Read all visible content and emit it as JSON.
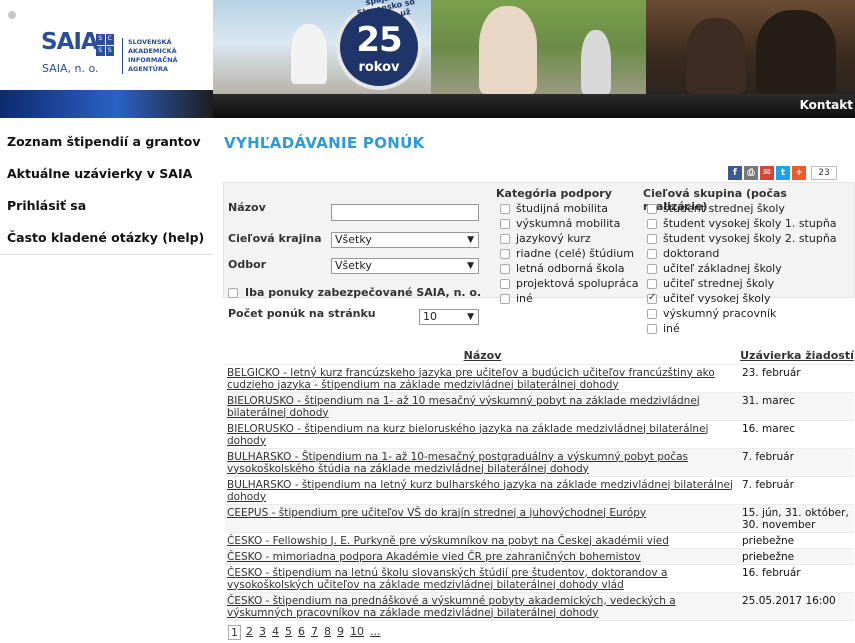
{
  "header": {
    "logo_word": "SAIA",
    "logo_grid": [
      "S",
      "C",
      "S",
      "S"
    ],
    "logo_sub": "SAIA, n. o.",
    "logo_lines": [
      "SLOVENSKÁ",
      "AKADEMICKÁ",
      "INFORMAČNÁ",
      "AGENTÚRA"
    ],
    "badge_arc": "spájame Slovensko so svetom už",
    "badge_number": "25",
    "badge_sub": "rokov",
    "nav_contact": "Kontakt"
  },
  "sidebar": {
    "items": [
      {
        "label": "Zoznam štipendií a grantov"
      },
      {
        "label": "Aktuálne uzávierky v SAIA"
      },
      {
        "label": "Prihlásiť sa"
      },
      {
        "label": "Často kladené otázky (help)"
      }
    ]
  },
  "page": {
    "title": "VYHĽADÁVANIE PONÚK",
    "share_count": "23"
  },
  "form": {
    "name_label": "Názov",
    "name_value": "",
    "country_label": "Cieľová krajina",
    "country_value": "Všetky",
    "field_label": "Odbor",
    "field_value": "Všetky",
    "saia_only_label": "Iba ponuky zabezpečované SAIA, n. o.",
    "per_page_label": "Počet ponúk na stránku",
    "per_page_value": "10",
    "category_heading": "Kategória podpory",
    "category_options": [
      {
        "label": "študijná mobilita",
        "checked": false
      },
      {
        "label": "výskumná mobilita",
        "checked": false
      },
      {
        "label": "jazykový kurz",
        "checked": false
      },
      {
        "label": "riadne (celé) štúdium",
        "checked": false
      },
      {
        "label": "letná odborná škola",
        "checked": false
      },
      {
        "label": "projektová spolupráca",
        "checked": false
      },
      {
        "label": "iné",
        "checked": false
      }
    ],
    "target_heading": "Cieľová skupina (počas realizácie)",
    "target_options": [
      {
        "label": "študent strednej školy",
        "checked": false
      },
      {
        "label": "študent vysokej školy 1. stupňa",
        "checked": false
      },
      {
        "label": "študent vysokej školy 2. stupňa",
        "checked": false
      },
      {
        "label": "doktorand",
        "checked": false
      },
      {
        "label": "učiteľ základnej školy",
        "checked": false
      },
      {
        "label": "učiteľ strednej školy",
        "checked": false
      },
      {
        "label": "učiteľ vysokej školy",
        "checked": true
      },
      {
        "label": "výskumný pracovník",
        "checked": false
      },
      {
        "label": "iné",
        "checked": false
      }
    ]
  },
  "results": {
    "col_name": "Názov",
    "col_deadline": "Uzávierka žiadostí",
    "rows": [
      {
        "name": "BELGICKO - letný kurz francúzskeho jazyka pre učiteľov a budúcich učiteľov francúzštiny ako cudzieho jazyka - štipendium na základe medzivládnej bilaterálnej dohody",
        "deadline": "23. február"
      },
      {
        "name": "BIELORUSKO - štipendium na 1- až 10 mesačný výskumný pobyt na základe medzivládnej bilaterálnej dohody",
        "deadline": "31. marec"
      },
      {
        "name": "BIELORUSKO - štipendium na kurz bieloruského jazyka na základe medzivládnej bilaterálnej dohody",
        "deadline": "16. marec"
      },
      {
        "name": "BULHARSKO - Štipendium na 1- až 10-mesačný postgraduálny a výskumný pobyt počas vysokoškolského štúdia na základe medzivládnej bilaterálnej dohody",
        "deadline": "7. február"
      },
      {
        "name": "BULHARSKO - štipendium na letný kurz bulharského jazyka na základe medzivládnej bilaterálnej dohody",
        "deadline": "7. február"
      },
      {
        "name": "CEEPUS - štipendium pre učiteľov VŠ do krajín strednej a juhovýchodnej Európy",
        "deadline": "15. jún, 31. október, 30. november"
      },
      {
        "name": "ČESKO - Fellowship J. E. Purkyně pre výskumníkov na pobyt na Českej akadémii vied",
        "deadline": "priebežne"
      },
      {
        "name": "ČESKO - mimoriadna podpora Akadémie vied ČR pre zahraničných bohemistov",
        "deadline": "priebežne"
      },
      {
        "name": "ČESKO - štipendium na letnú školu slovanských štúdií pre študentov, doktorandov a vysokoškolských učiteľov na základe medzivládnej bilaterálnej dohody vlád",
        "deadline": "16. február"
      },
      {
        "name": "ČESKO - štipendium na prednáškové a výskumné pobyty akademických, vedeckých a výskumných pracovníkov na základe medzivládnej bilaterálnej dohody",
        "deadline": "25.05.2017 16:00"
      }
    ]
  },
  "pager": {
    "pages": [
      "1",
      "2",
      "3",
      "4",
      "5",
      "6",
      "7",
      "8",
      "9",
      "10",
      "..."
    ],
    "current": "1"
  },
  "colors": {
    "title_blue": "#2e9ad6",
    "brand_blue": "#2a4f98"
  }
}
